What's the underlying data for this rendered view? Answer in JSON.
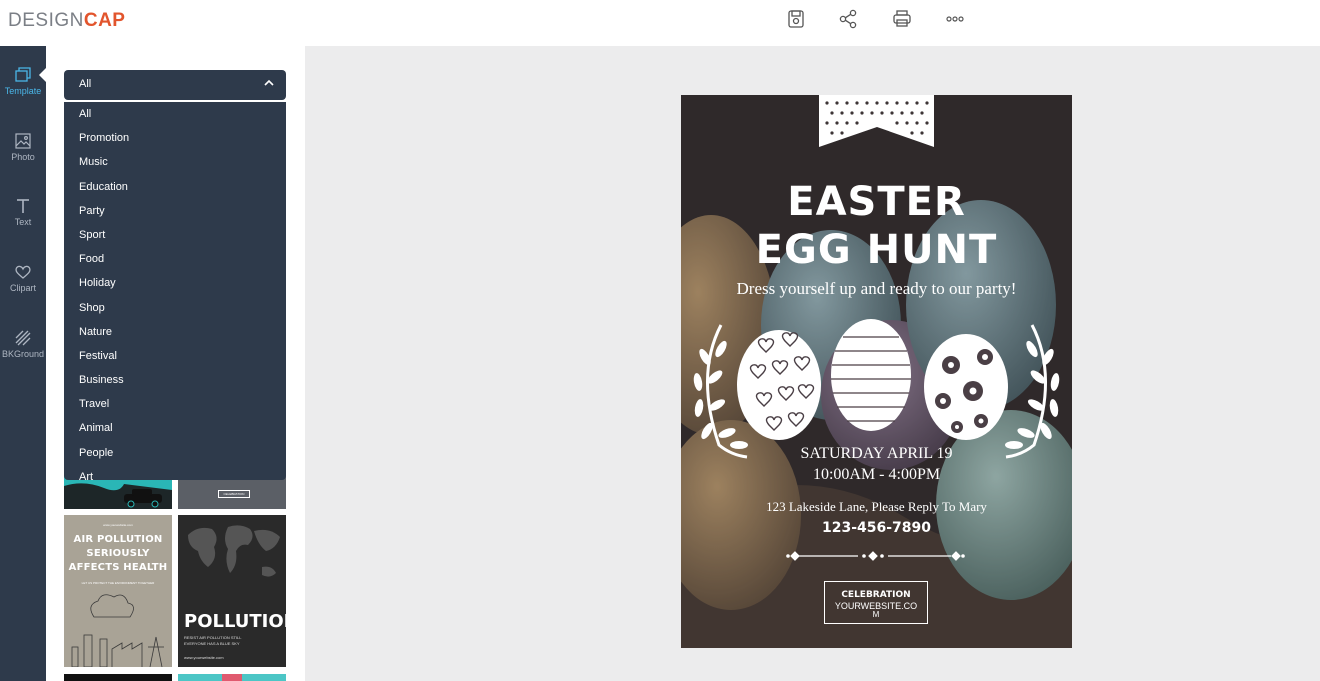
{
  "app": {
    "logo_light": "DESIGN",
    "logo_bold": "CAP"
  },
  "toolbar": {
    "icons": [
      "save-icon",
      "share-icon",
      "print-icon",
      "more-icon"
    ]
  },
  "rail": {
    "items": [
      {
        "label": "Template",
        "icon": "template-icon",
        "active": true
      },
      {
        "label": "Photo",
        "icon": "photo-icon",
        "active": false
      },
      {
        "label": "Text",
        "icon": "text-icon",
        "active": false
      },
      {
        "label": "Clipart",
        "icon": "heart-icon",
        "active": false
      },
      {
        "label": "BKGround",
        "icon": "background-icon",
        "active": false
      }
    ]
  },
  "category_select": {
    "selected": "All",
    "options": [
      "All",
      "Promotion",
      "Music",
      "Education",
      "Party",
      "Sport",
      "Food",
      "Holiday",
      "Shop",
      "Nature",
      "Festival",
      "Business",
      "Travel",
      "Animal",
      "People",
      "Art"
    ]
  },
  "thumbnails": {
    "beige": {
      "top_small": "www.yourwebsite.com",
      "title_line1": "AIR POLLUTION",
      "title_line2": "SERIOUSLY",
      "title_line3": "AFFECTS HEALTH",
      "subtitle": "LET US PROTECT THE ENVIRONMENT TOGETHER"
    },
    "black": {
      "title": "POLLUTION",
      "sub1": "RESIST AIR POLLUTION STILL",
      "sub2": "EVERYONE HAS A BLUE SKY",
      "site": "www.yourwebsite.com"
    },
    "dark_small": "CELEBRATION"
  },
  "poster": {
    "title_line1": "EASTER",
    "title_line2": "EGG HUNT",
    "tagline": "Dress yourself up and ready to our party!",
    "date": "SATURDAY APRIL 19",
    "time": "10:00AM - 4:00PM",
    "address": "123 Lakeside Lane, Please Reply To Mary",
    "phone": "123-456-7890",
    "box_line1": "CELEBRATION",
    "box_line2": "YOURWEBSITE.CO",
    "box_line3": "M"
  },
  "colors": {
    "brand_accent": "#e2552d",
    "rail_bg": "#2e3a4b",
    "active": "#4ab6e8",
    "canvas_bg": "#ececed"
  }
}
